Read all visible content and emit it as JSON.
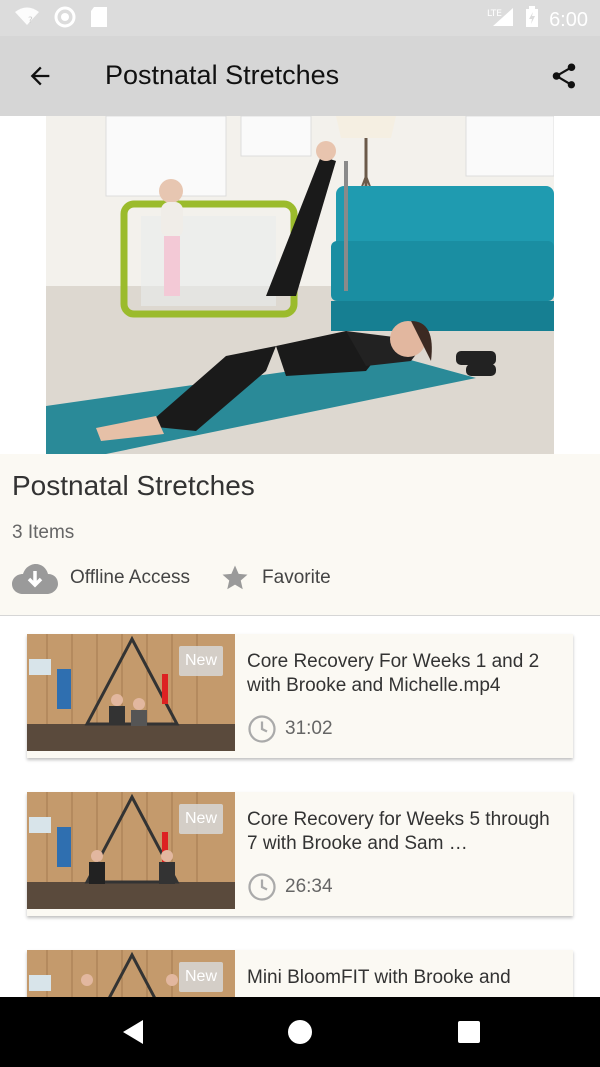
{
  "status": {
    "time": "6:00",
    "network": "LTE"
  },
  "appbar": {
    "title": "Postnatal Stretches"
  },
  "info": {
    "title": "Postnatal Stretches",
    "count": "3 Items",
    "offline_label": "Offline Access",
    "favorite_label": "Favorite"
  },
  "items": [
    {
      "badge": "New",
      "title": "Core Recovery For Weeks 1 and 2 with Brooke and Michelle.mp4",
      "duration": "31:02"
    },
    {
      "badge": "New",
      "title": "Core Recovery for Weeks 5 through 7 with Brooke and  Sam …",
      "duration": "26:34"
    },
    {
      "badge": "New",
      "title": "Mini BloomFIT with Brooke and",
      "duration": ""
    }
  ],
  "icons": {
    "back": "arrow-left-icon",
    "share": "share-icon",
    "offline": "cloud-download-icon",
    "favorite": "star-icon",
    "clock": "clock-icon"
  },
  "colors": {
    "appbar": "#d6d6d6",
    "info_bg": "#fbf9f3",
    "mat": "#2a8a98",
    "sofa": "#1f9bb0"
  }
}
